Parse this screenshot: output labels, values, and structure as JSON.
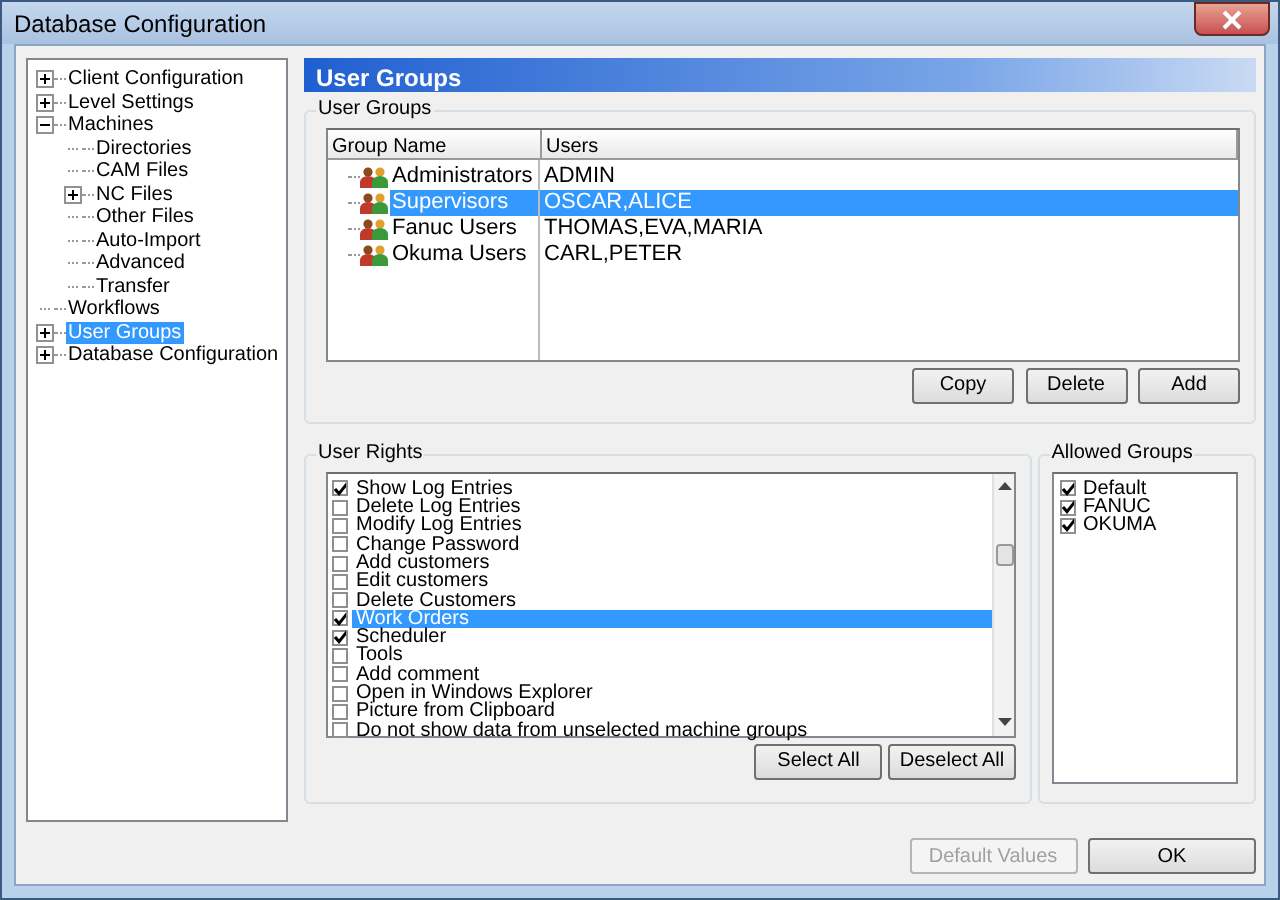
{
  "window": {
    "title": "Database Configuration"
  },
  "tree": [
    {
      "label": "Client Configuration",
      "expanded": false,
      "selected": false
    },
    {
      "label": "Level Settings",
      "expanded": false,
      "selected": false
    },
    {
      "label": "Machines",
      "expanded": true,
      "selected": false,
      "children": [
        {
          "label": "Directories",
          "selected": false
        },
        {
          "label": "CAM Files",
          "selected": false
        },
        {
          "label": "NC Files",
          "expanded": false,
          "selected": false
        },
        {
          "label": "Other Files",
          "selected": false
        },
        {
          "label": "Auto-Import",
          "selected": false
        },
        {
          "label": "Advanced",
          "selected": false
        },
        {
          "label": "Transfer",
          "selected": false
        }
      ]
    },
    {
      "label": "Workflows",
      "selected": false
    },
    {
      "label": "User Groups",
      "expanded": false,
      "selected": true
    },
    {
      "label": "Database Configuration",
      "expanded": false,
      "selected": false
    }
  ],
  "header": "User Groups",
  "user_groups": {
    "title": "User Groups",
    "columns": [
      "Group Name",
      "Users"
    ],
    "rows": [
      {
        "name": "Administrators",
        "users": "ADMIN",
        "selected": false
      },
      {
        "name": "Supervisors",
        "users": "OSCAR,ALICE",
        "selected": true
      },
      {
        "name": "Fanuc Users",
        "users": "THOMAS,EVA,MARIA",
        "selected": false
      },
      {
        "name": "Okuma Users",
        "users": "CARL,PETER",
        "selected": false
      }
    ],
    "buttons": [
      "Copy",
      "Delete",
      "Add"
    ]
  },
  "user_rights": {
    "title": "User Rights",
    "items": [
      {
        "label": "Show Log Entries",
        "checked": true,
        "selected": false
      },
      {
        "label": "Delete Log Entries",
        "checked": false,
        "selected": false
      },
      {
        "label": "Modify Log Entries",
        "checked": false,
        "selected": false
      },
      {
        "label": "Change Password",
        "checked": false,
        "selected": false
      },
      {
        "label": "Add customers",
        "checked": false,
        "selected": false
      },
      {
        "label": "Edit customers",
        "checked": false,
        "selected": false
      },
      {
        "label": "Delete Customers",
        "checked": false,
        "selected": false
      },
      {
        "label": "Work Orders",
        "checked": true,
        "selected": true
      },
      {
        "label": "Scheduler",
        "checked": true,
        "selected": false
      },
      {
        "label": "Tools",
        "checked": false,
        "selected": false
      },
      {
        "label": "Add comment",
        "checked": false,
        "selected": false
      },
      {
        "label": "Open in Windows Explorer",
        "checked": false,
        "selected": false
      },
      {
        "label": "Picture from Clipboard",
        "checked": false,
        "selected": false
      },
      {
        "label": "Do not show data from unselected machine groups",
        "checked": false,
        "selected": false
      }
    ],
    "buttons": [
      "Select All",
      "Deselect All"
    ]
  },
  "allowed_groups": {
    "title": "Allowed Groups",
    "items": [
      {
        "label": "Default",
        "checked": true
      },
      {
        "label": "FANUC",
        "checked": true
      },
      {
        "label": "OKUMA",
        "checked": true
      }
    ]
  },
  "footer_buttons": [
    {
      "label": "Default Values",
      "disabled": true
    },
    {
      "label": "OK",
      "disabled": false
    }
  ]
}
